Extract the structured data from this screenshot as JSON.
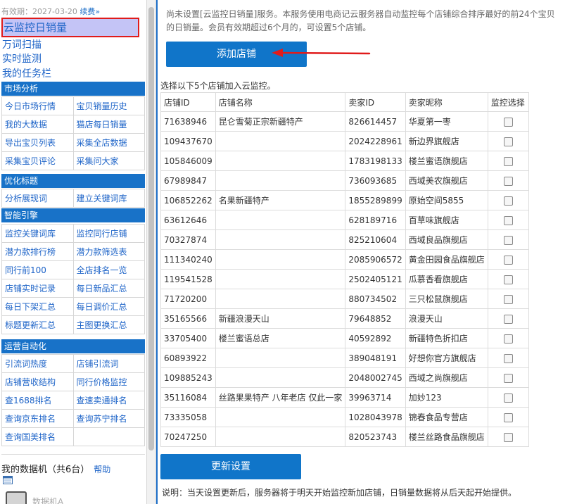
{
  "sidebar": {
    "expiry_text": "有效期：2027-03-20",
    "renew_label": "续费»",
    "selected_item": "云监控日销量",
    "links": [
      "万词扫描",
      "实时监测",
      "我的任务栏"
    ],
    "sections": [
      {
        "title": "市场分析",
        "items": [
          "今日市场行情",
          "宝贝销量历史",
          "我的大数据",
          "猫店每日销量",
          "导出宝贝列表",
          "采集全店数据",
          "采集宝贝评论",
          "采集问大家"
        ]
      },
      {
        "title": "优化标题",
        "items": [
          "分析展现词",
          "建立关键词库"
        ]
      },
      {
        "title": "智能引擎",
        "items": [
          "监控关键词库",
          "监控同行店铺",
          "潜力款排行榜",
          "潜力款筛选表",
          "同行前100",
          "全店排名一览",
          "店铺实时记录",
          "每日新品汇总",
          "每日下架汇总",
          "每日调价汇总",
          "标题更新汇总",
          "主图更换汇总"
        ]
      },
      {
        "title": "运营自动化",
        "items": [
          "引流词热度",
          "店铺引流词",
          "店铺营收结构",
          "同行价格监控",
          "查1688排名",
          "查速卖通排名",
          "查询京东排名",
          "查询苏宁排名",
          "查询国美排名",
          ""
        ]
      }
    ],
    "my_data_label": "我的数据机（共6台）",
    "help_label": "帮助",
    "machine_label": "数据机A"
  },
  "main": {
    "notice": "尚未设置[云监控日销量]服务。本服务使用电商记云服务器自动监控每个店铺综合排序最好的前24个宝贝的日销量。会员有效期超过6个月的，可设置5个店铺。",
    "add_button": "添加店铺",
    "select_hint": "选择以下5个店铺加入云监控。",
    "table_headers": [
      "店铺ID",
      "店铺名称",
      "卖家ID",
      "卖家昵称",
      "监控选择"
    ],
    "rows": [
      {
        "shop_id": "71638946",
        "shop_name": "昆仑雪菊正宗新疆特产",
        "seller_id": "826614457",
        "seller_nick": "华夏第一枣"
      },
      {
        "shop_id": "109437670",
        "shop_name": "",
        "seller_id": "2024228961",
        "seller_nick": "新边界旗舰店"
      },
      {
        "shop_id": "105846009",
        "shop_name": "",
        "seller_id": "1783198133",
        "seller_nick": "楼兰蜜语旗舰店"
      },
      {
        "shop_id": "67989847",
        "shop_name": "",
        "seller_id": "736093685",
        "seller_nick": "西域美农旗舰店"
      },
      {
        "shop_id": "106852262",
        "shop_name": "名果新疆特产",
        "seller_id": "1855289899",
        "seller_nick": "原始空间5855"
      },
      {
        "shop_id": "63612646",
        "shop_name": "",
        "seller_id": "628189716",
        "seller_nick": "百草味旗舰店"
      },
      {
        "shop_id": "70327874",
        "shop_name": "",
        "seller_id": "825210604",
        "seller_nick": "西域良品旗舰店"
      },
      {
        "shop_id": "111340240",
        "shop_name": "",
        "seller_id": "2085906572",
        "seller_nick": "黄金田园食品旗舰店"
      },
      {
        "shop_id": "119541528",
        "shop_name": "",
        "seller_id": "2502405121",
        "seller_nick": "瓜慕香看旗舰店"
      },
      {
        "shop_id": "71720200",
        "shop_name": "",
        "seller_id": "880734502",
        "seller_nick": "三只松鼠旗舰店"
      },
      {
        "shop_id": "35165566",
        "shop_name": "新疆浪漫天山",
        "seller_id": "79648852",
        "seller_nick": "浪漫天山"
      },
      {
        "shop_id": "33705400",
        "shop_name": "楼兰蜜语总店",
        "seller_id": "40592892",
        "seller_nick": "新疆特色折扣店"
      },
      {
        "shop_id": "60893922",
        "shop_name": "",
        "seller_id": "389048191",
        "seller_nick": "好想你官方旗舰店"
      },
      {
        "shop_id": "109885243",
        "shop_name": "",
        "seller_id": "2048002745",
        "seller_nick": "西域之尚旗舰店"
      },
      {
        "shop_id": "35116084",
        "shop_name": "丝路果果特产 八年老店 仅此一家",
        "seller_id": "39963714",
        "seller_nick": "加妙123"
      },
      {
        "shop_id": "73335058",
        "shop_name": "",
        "seller_id": "1028043978",
        "seller_nick": "锦春食品专营店"
      },
      {
        "shop_id": "70247250",
        "shop_name": "",
        "seller_id": "820523743",
        "seller_nick": "楼兰丝路食品旗舰店"
      }
    ],
    "update_button": "更新设置",
    "footnote": "说明：当天设置更新后，服务器将于明天开始监控新加店铺，日销量数据将从后天起开始提供。"
  },
  "colors": {
    "accent": "#1075c9",
    "section_header": "#1872c8",
    "link": "#1e64c8",
    "selected_bg": "#c4c4f6",
    "highlight_border": "#e01b1b",
    "arrow": "#e01b1b"
  },
  "icons": [
    "calendar-icon",
    "data-machine-icon",
    "red-arrow-icon"
  ]
}
